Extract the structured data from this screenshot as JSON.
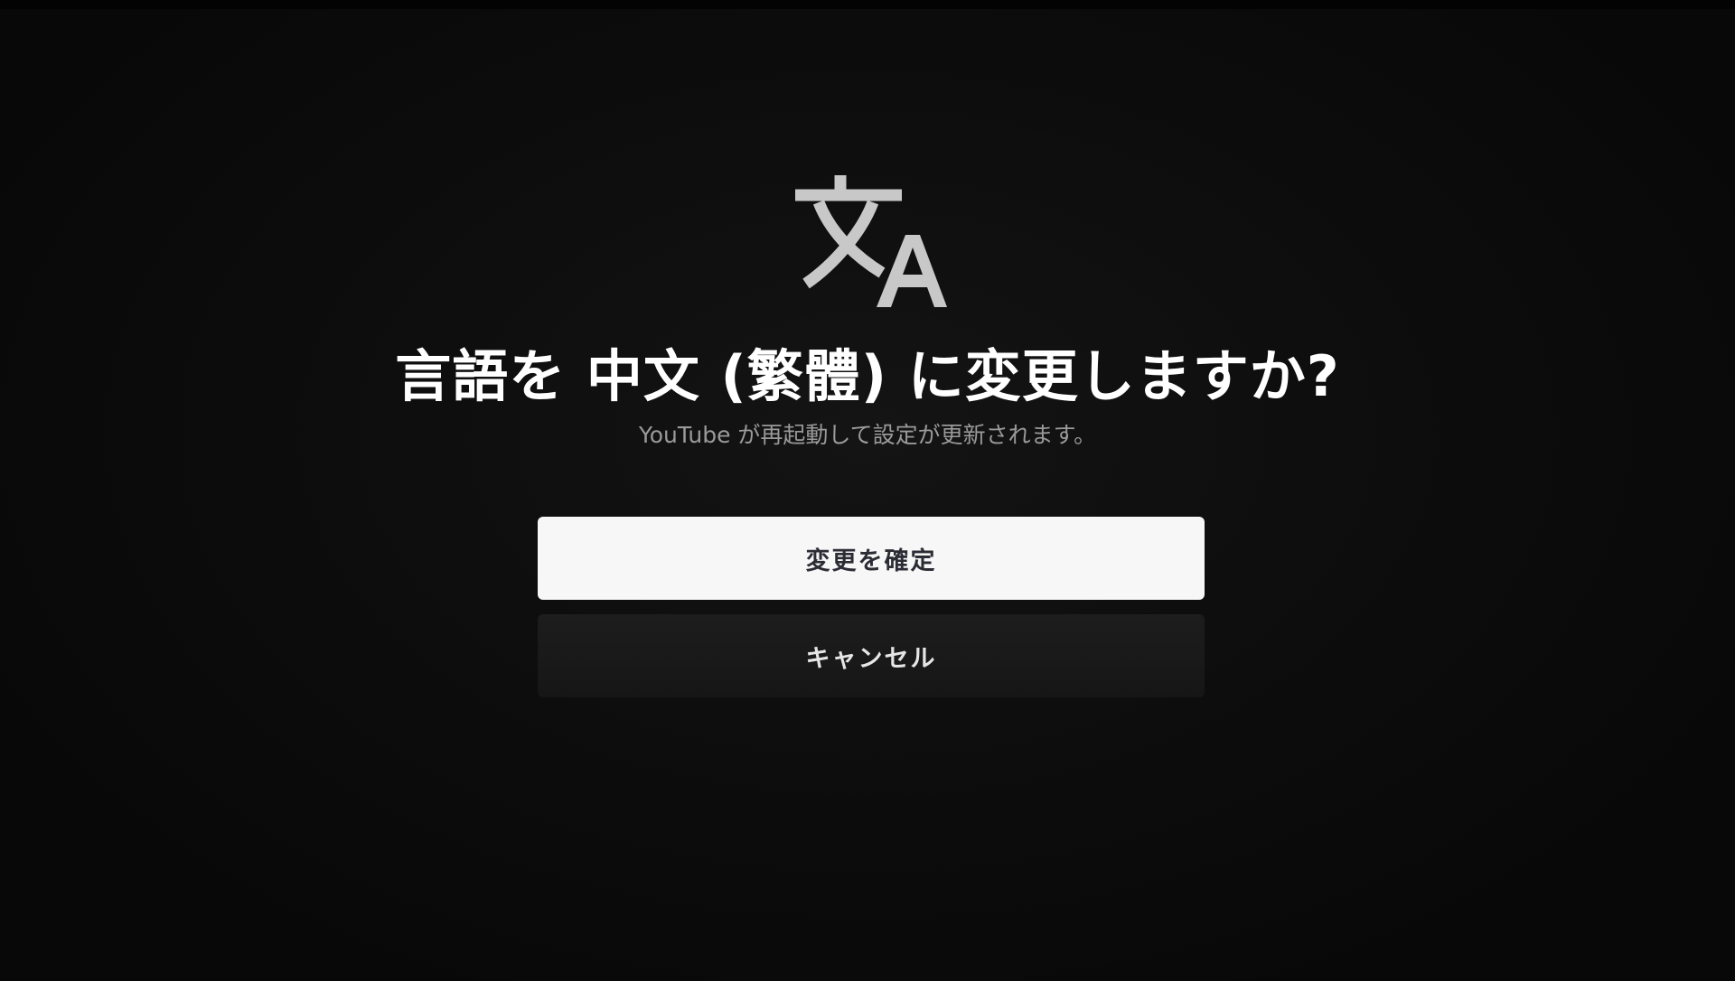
{
  "dialog": {
    "icon": "translate-icon",
    "title": "言語を 中文 (繁體) に変更しますか?",
    "subtitle": "YouTube が再起動して設定が更新されます。",
    "confirm_label": "変更を確定",
    "cancel_label": "キャンセル"
  },
  "colors": {
    "background": "#0b0b0b",
    "icon": "#c8c8c8",
    "title": "#ffffff",
    "subtitle": "#9a9a9a",
    "confirm_bg": "#f7f7f7",
    "confirm_text": "#2c2c35",
    "cancel_bg": "#1b1b1b",
    "cancel_text": "#e6e6e6"
  }
}
